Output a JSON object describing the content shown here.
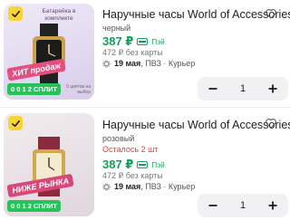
{
  "cart_items": [
    {
      "promo": "Батарейка в комплекте",
      "sticker": "ХИТ продаж",
      "split": "0 0 1 2 СПЛИТ",
      "split_note": "5 цветов на выбор",
      "title": "Наручные часы World of Accessories",
      "color": "черный",
      "stock": "",
      "price": "387 ₽",
      "pay_label": "Пэй",
      "old_price": "472 ₽  без карты",
      "delivery_date": "19 мая",
      "delivery_rest": ", ПВЗ · Курьер",
      "qty": "1"
    },
    {
      "promo": "",
      "sticker": "НИЖЕ РЫНКА",
      "split": "0 0 1 2 СПЛИТ",
      "split_note": "",
      "title": "Наручные часы World of Accessories",
      "color": "розовый",
      "stock": "Осталось 2 шт",
      "price": "387 ₽",
      "pay_label": "Пэй",
      "old_price": "472 ₽  без карты",
      "delivery_date": "19 мая",
      "delivery_rest": ", ПВЗ · Курьер",
      "qty": "1"
    }
  ],
  "icons": {
    "favorite": "heart-icon",
    "delivery": "gear-icon",
    "decrease": "minus-icon",
    "increase": "plus-icon",
    "selected": "checkmark-icon"
  },
  "colors": {
    "price_green": "#14a05a",
    "badge_yellow": "#f7d633",
    "stock_red": "#e23a3a",
    "split_green": "#27c25a"
  }
}
